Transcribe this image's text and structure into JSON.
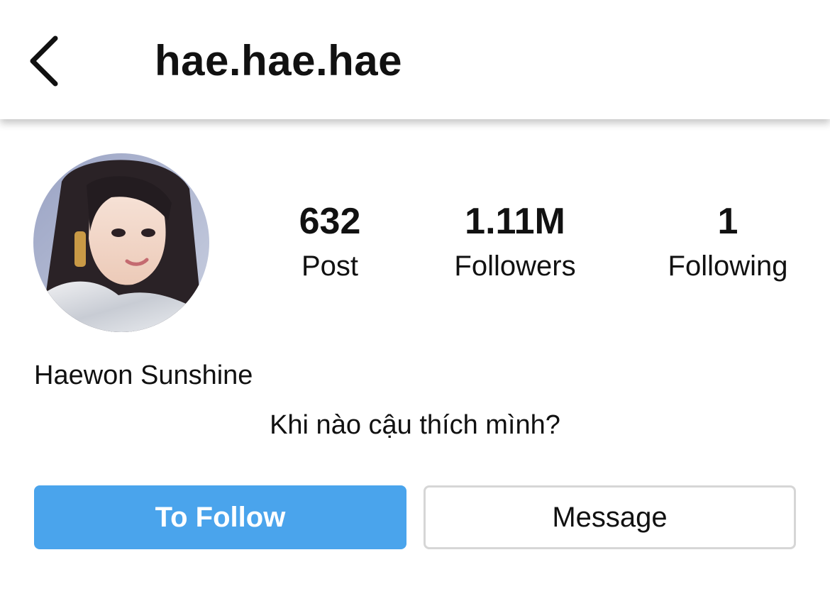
{
  "header": {
    "back_icon": "chevron-left-icon",
    "username": "hae.hae.hae"
  },
  "profile": {
    "avatar_icon": "profile-photo",
    "display_name": "Haewon Sunshine",
    "bio": "Khi nào cậu thích mình?"
  },
  "stats": {
    "posts": {
      "value": "632",
      "label": "Post"
    },
    "followers": {
      "value": "1.11M",
      "label": "Followers"
    },
    "following": {
      "value": "1",
      "label": "Following"
    }
  },
  "actions": {
    "follow_label": "To Follow",
    "message_label": "Message"
  },
  "colors": {
    "follow_button": "#4aa4ec",
    "message_border": "#d6d6d6",
    "text": "#111111"
  }
}
